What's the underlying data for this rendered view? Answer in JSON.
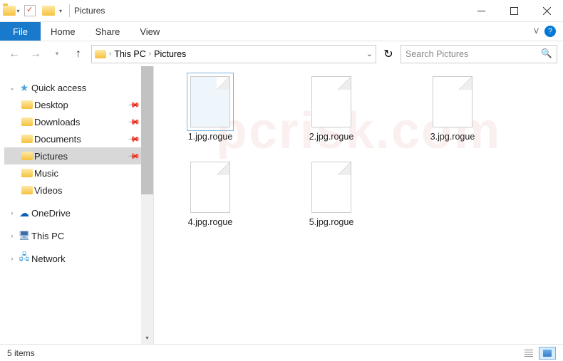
{
  "title": "Pictures",
  "ribbon": {
    "file": "File",
    "tabs": [
      "Home",
      "Share",
      "View"
    ]
  },
  "breadcrumb": {
    "root": "This PC",
    "current": "Pictures"
  },
  "search": {
    "placeholder": "Search Pictures"
  },
  "tree": {
    "quick_access": "Quick access",
    "items": [
      {
        "label": "Desktop"
      },
      {
        "label": "Downloads"
      },
      {
        "label": "Documents"
      },
      {
        "label": "Pictures"
      },
      {
        "label": "Music"
      },
      {
        "label": "Videos"
      }
    ],
    "onedrive": "OneDrive",
    "thispc": "This PC",
    "network": "Network"
  },
  "files": [
    {
      "name": "1.jpg.rogue",
      "selected": true
    },
    {
      "name": "2.jpg.rogue"
    },
    {
      "name": "3.jpg.rogue"
    },
    {
      "name": "4.jpg.rogue"
    },
    {
      "name": "5.jpg.rogue"
    }
  ],
  "status": {
    "count": "5 items"
  },
  "watermark": "pcrisk.com"
}
